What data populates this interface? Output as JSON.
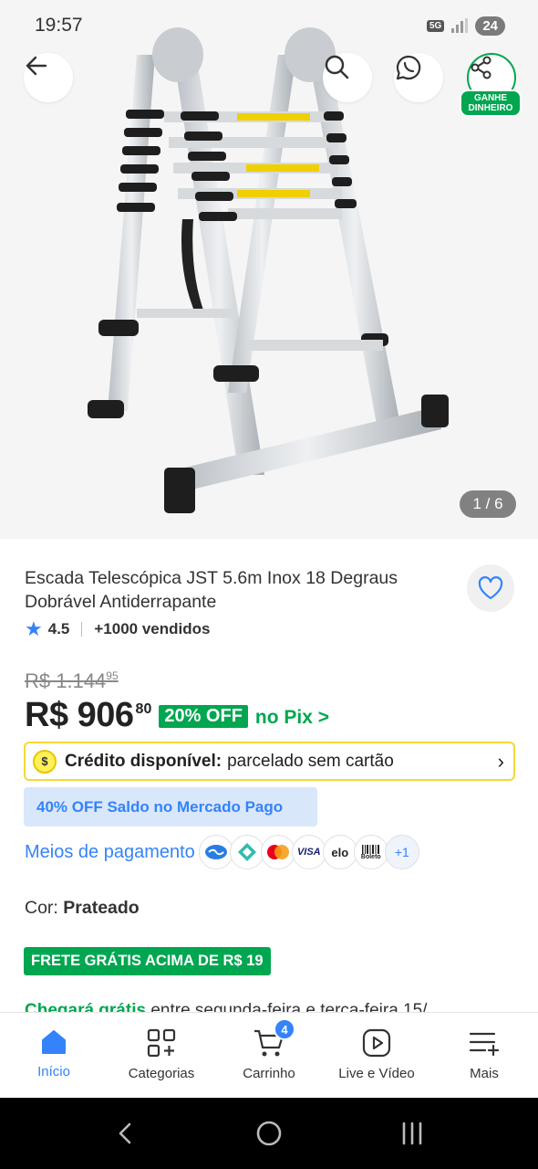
{
  "status_bar": {
    "time": "19:57",
    "network": "5G",
    "battery": "24"
  },
  "header": {
    "back_icon": "arrow-left-icon",
    "search_icon": "search-icon",
    "whatsapp_icon": "whatsapp-icon",
    "share_icon": "share-icon",
    "share_badge": "GANHE DINHEIRO"
  },
  "gallery": {
    "counter": "1 / 6"
  },
  "product": {
    "title": "Escada Telescópica JST 5.6m Inox 18 Degraus Dobrável Antiderrapante",
    "rating": "4.5",
    "sold": "+1000 vendidos",
    "old_price_main": "R$ 1.144",
    "old_price_cents": "95",
    "price_main": "R$ 906",
    "price_cents": "80",
    "discount": "20% OFF",
    "pix_label": "no Pix >",
    "credit_bold": "Crédito disponível:",
    "credit_text": "parcelado sem cartão",
    "saldo_badge": "40% OFF Saldo no Mercado Pago",
    "payment_link": "Meios de pagamento",
    "payment_icons": [
      "mercadopago-icon",
      "pix-icon",
      "mastercard-icon",
      "visa-icon",
      "elo-icon",
      "boleto-icon"
    ],
    "payment_more": "+1",
    "visa_label": "VISA",
    "elo_label": "elo",
    "boleto_label": "Boleto",
    "color_label": "Cor:",
    "color_value": "Prateado",
    "shipping_badge": "FRETE GRÁTIS ACIMA DE R$ 19",
    "delivery_green": "Chegará grátis",
    "delivery_text": "entre segunda-feira e terça-feira 15/"
  },
  "bottom_nav": {
    "items": [
      {
        "label": "Início",
        "icon": "home-icon"
      },
      {
        "label": "Categorias",
        "icon": "categories-icon"
      },
      {
        "label": "Carrinho",
        "icon": "cart-icon"
      },
      {
        "label": "Live e Vídeo",
        "icon": "play-icon"
      },
      {
        "label": "Mais",
        "icon": "menu-plus-icon"
      }
    ],
    "cart_count": "4"
  },
  "colors": {
    "accent_blue": "#3483fa",
    "green": "#00a650",
    "yellow": "#f5d838"
  }
}
